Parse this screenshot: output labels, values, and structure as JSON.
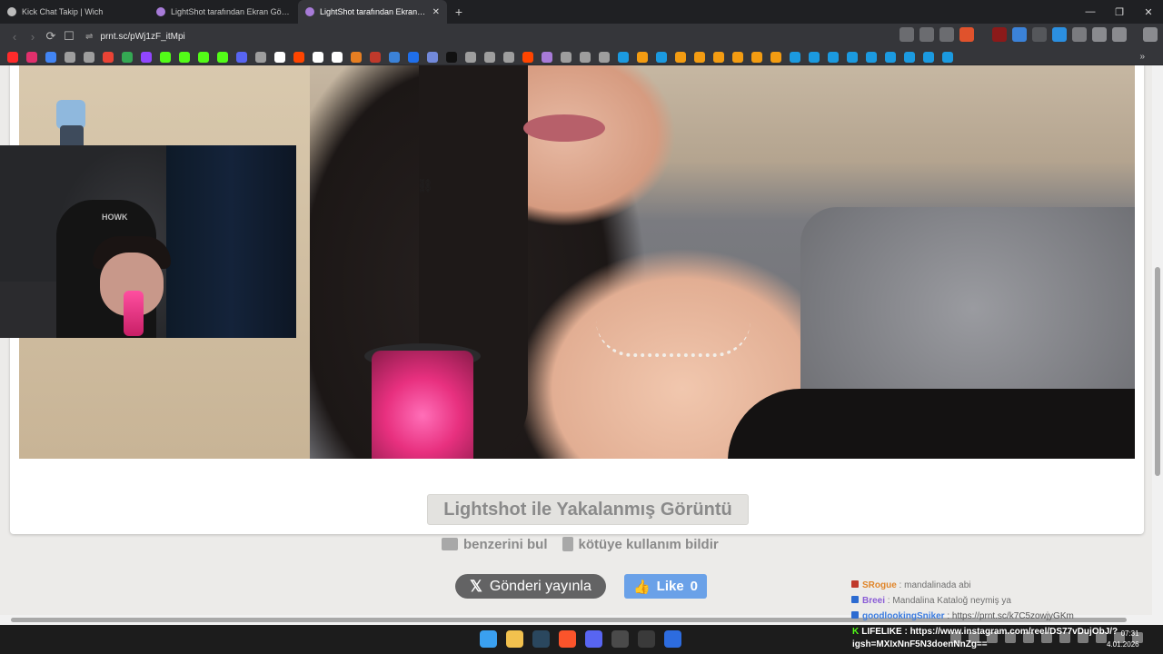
{
  "tabs": [
    {
      "title": "Kick Chat Takip | Wich",
      "color": "#bbbbbb"
    },
    {
      "title": "LightShot tarafından Ekran Görüntü",
      "color": "#a77bd8"
    },
    {
      "title": "LightShot tarafından Ekran Görü",
      "color": "#a77bd8",
      "close": "✕"
    }
  ],
  "new_tab": "+",
  "window_controls": {
    "minimize": "—",
    "restore": "❐",
    "close": "✕"
  },
  "toolbar": {
    "back": "‹",
    "forward": "›",
    "reload": "⟳",
    "bookmark": "☐",
    "url": "prnt.sc/pWj1zF_itMpi",
    "tune": "⇌"
  },
  "bookmarks_more": "»",
  "page": {
    "title": "Lightshot ile Yakalanmış Görüntü",
    "similar_label": "benzerini bul",
    "report_label": "kötüye kullanım bildir",
    "tweet_label": "Gönderi yayınla",
    "x_glyph": "𝕏",
    "like_label": "Like",
    "like_count": "0",
    "like_glyph": "👍",
    "pin_glyph": "⛓"
  },
  "webcam": {
    "chair_logo": "HOWK"
  },
  "chat": [
    {
      "user": "SRogue",
      "sep": " : ",
      "message": "mandalinada abi"
    },
    {
      "user": "Breei",
      "sep": " : ",
      "message": "Mandalina Kataloğ neymiş ya"
    },
    {
      "user": "goodlookingSniker",
      "sep": " : ",
      "message": "https://prnt.sc/k7C5zowjyGKm"
    }
  ],
  "lifelike": {
    "badge": "K",
    "user": "LIFELIKE",
    "message_line1": "https://www.instagram.com/reel/DS77vDujObJ/?",
    "message_line2": "igsh=MXIxNnF5N3doenNnZg=="
  },
  "clock": {
    "time": "07:31",
    "date": "4.01.2026"
  },
  "colors": {
    "accent": "#6aa1e8",
    "tweet": "#636364",
    "kick_green": "#53fc18"
  }
}
